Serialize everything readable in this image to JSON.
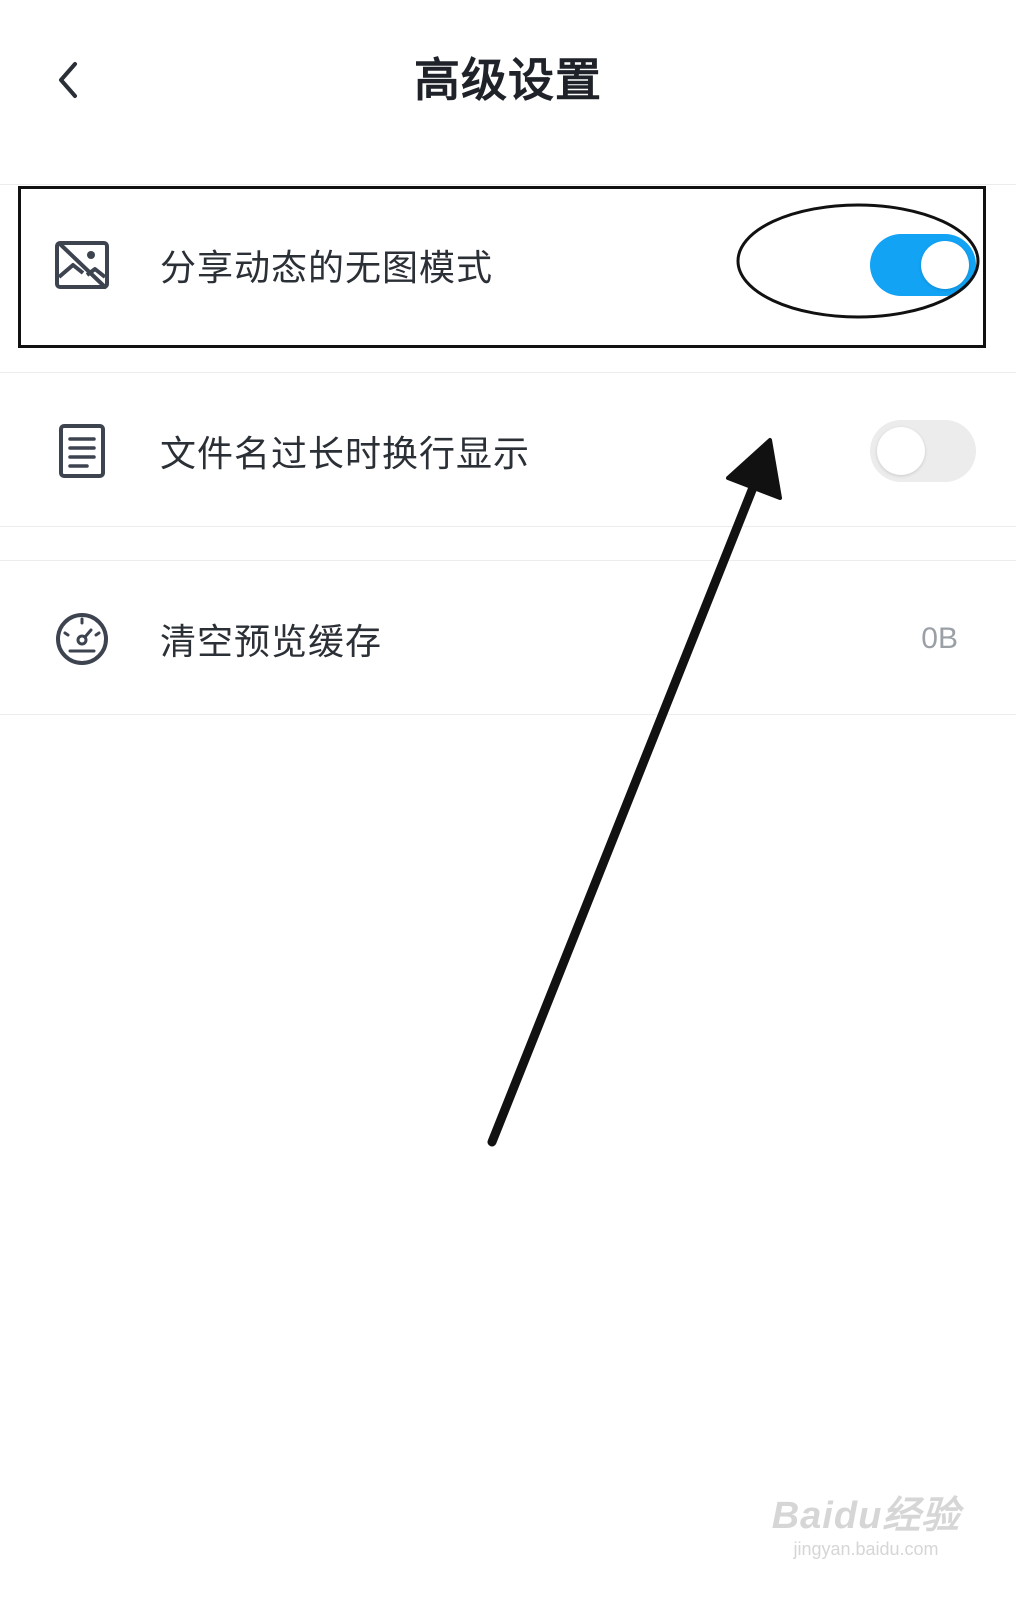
{
  "header": {
    "title": "高级设置",
    "back_icon": "chevron-left-icon"
  },
  "settings": [
    {
      "label": "分享动态的无图模式",
      "icon": "image-off-icon",
      "control": "toggle",
      "state": "on"
    },
    {
      "label": "文件名过长时换行显示",
      "icon": "document-icon",
      "control": "toggle",
      "state": "off"
    },
    {
      "label": "清空预览缓存",
      "icon": "speedometer-icon",
      "control": "value",
      "value": "0B"
    }
  ],
  "colors": {
    "toggle_on": "#12a3f5",
    "toggle_off": "#ececec",
    "text": "#2b2f36",
    "value_text": "#9aa0a6",
    "annotation": "#111111"
  },
  "watermark": {
    "main": "Baidu经验",
    "sub": "jingyan.baidu.com"
  }
}
